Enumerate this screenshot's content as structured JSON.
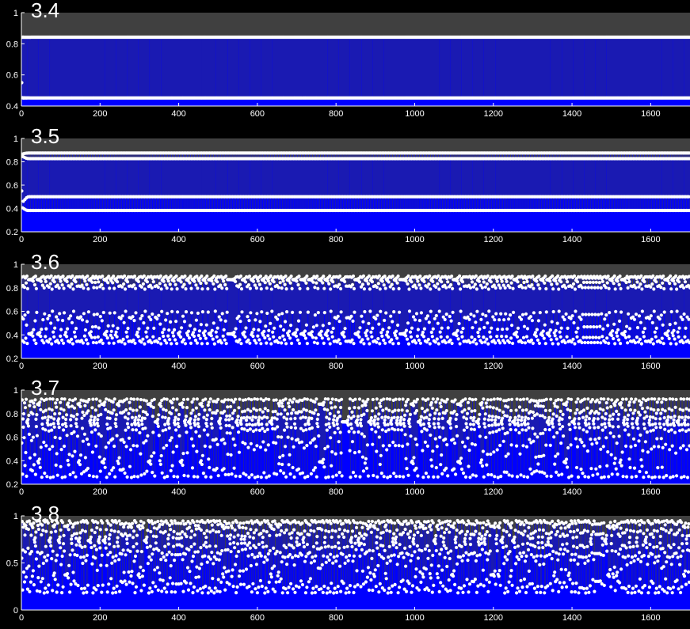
{
  "colors": {
    "background": "#000000",
    "axes_bg": "#404040",
    "stem": "#0000ff",
    "marker": "#ffffff"
  },
  "chart_data": [
    {
      "type": "scatter",
      "title": "3.4",
      "xlim": [
        0,
        1700
      ],
      "ylim": [
        0.4,
        1
      ],
      "xticks": [
        "0",
        "200",
        "400",
        "600",
        "800",
        "1000",
        "1200",
        "1400",
        "1600"
      ],
      "yticks": [
        "0.4",
        "0.6",
        "0.8",
        "1"
      ],
      "grid": false,
      "r": 3.4,
      "series_style": "stem with circle markers",
      "marker_values": [
        0.452,
        0.842
      ]
    },
    {
      "type": "scatter",
      "title": "3.5",
      "xlim": [
        0,
        1700
      ],
      "ylim": [
        0.2,
        1
      ],
      "xticks": [
        "0",
        "200",
        "400",
        "600",
        "800",
        "1000",
        "1200",
        "1400",
        "1600"
      ],
      "yticks": [
        "0.2",
        "0.4",
        "0.6",
        "0.8",
        "1"
      ],
      "grid": false,
      "r": 3.5,
      "series_style": "stem with circle markers",
      "marker_values": [
        0.383,
        0.501,
        0.827,
        0.875
      ]
    },
    {
      "type": "scatter",
      "title": "3.6",
      "xlim": [
        0,
        1700
      ],
      "ylim": [
        0.2,
        1
      ],
      "xticks": [
        "0",
        "200",
        "400",
        "600",
        "800",
        "1000",
        "1200",
        "1400",
        "1600"
      ],
      "yticks": [
        "0.2",
        "0.4",
        "0.6",
        "0.8",
        "1"
      ],
      "grid": false,
      "r": 3.6,
      "series_style": "stem with circle markers",
      "marker_range": [
        0.32,
        0.9
      ]
    },
    {
      "type": "scatter",
      "title": "3.7",
      "xlim": [
        0,
        1700
      ],
      "ylim": [
        0.2,
        1
      ],
      "xticks": [
        "0",
        "200",
        "400",
        "600",
        "800",
        "1000",
        "1200",
        "1400",
        "1600"
      ],
      "yticks": [
        "0.2",
        "0.4",
        "0.6",
        "0.8",
        "1"
      ],
      "grid": false,
      "r": 3.7,
      "series_style": "stem with circle markers",
      "marker_range": [
        0.25,
        0.925
      ]
    },
    {
      "type": "scatter",
      "title": "3.8",
      "xlim": [
        0,
        1700
      ],
      "ylim": [
        0,
        1
      ],
      "xticks": [
        "0",
        "200",
        "400",
        "600",
        "800",
        "1000",
        "1200",
        "1400",
        "1600"
      ],
      "yticks": [
        "0",
        "0.5",
        "1"
      ],
      "grid": false,
      "r": 3.8,
      "series_style": "stem with circle markers",
      "marker_range": [
        0.18,
        0.95
      ]
    }
  ]
}
